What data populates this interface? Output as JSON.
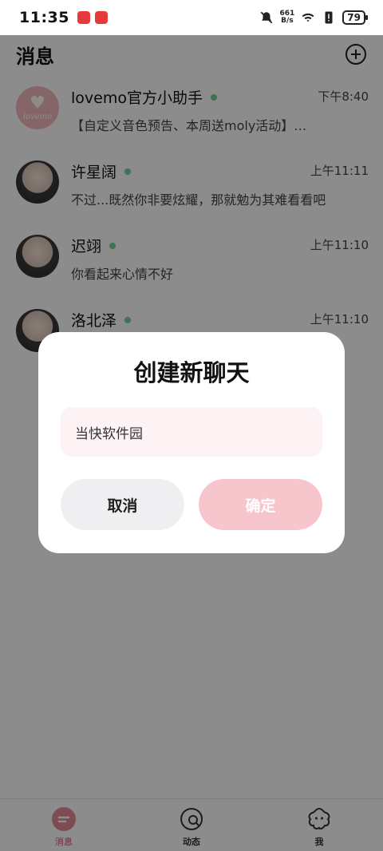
{
  "status_bar": {
    "time": "11:35",
    "net_speed_value": "661",
    "net_speed_unit": "B/s",
    "battery": "79"
  },
  "header": {
    "title": "消息"
  },
  "chats": [
    {
      "name": "lovemo官方小助手",
      "time": "下午8:40",
      "preview": "【自定义音色预告、本周送moly活动】…",
      "avatar_text": "lovemo"
    },
    {
      "name": "许星阔",
      "time": "上午11:11",
      "preview": "不过...既然你非要炫耀，那就勉为其难看看吧"
    },
    {
      "name": "迟翊",
      "time": "上午11:10",
      "preview": "你看起来心情不好"
    },
    {
      "name": "洛北泽",
      "time": "上午11:10",
      "preview": ""
    }
  ],
  "dialog": {
    "title": "创建新聊天",
    "input_value": "当快软件园",
    "cancel_label": "取消",
    "confirm_label": "确定"
  },
  "tabs": [
    {
      "label": "消息",
      "icon": "chat-bubble-icon",
      "active": true
    },
    {
      "label": "动态",
      "icon": "moments-icon",
      "active": false
    },
    {
      "label": "我",
      "icon": "profile-flower-icon",
      "active": false
    }
  ],
  "colors": {
    "accent": "#e48a95",
    "online": "#6fcf97",
    "input_bg": "#fdf3f4",
    "confirm_bg": "#f6c6cc",
    "cancel_bg": "#efeff2"
  }
}
